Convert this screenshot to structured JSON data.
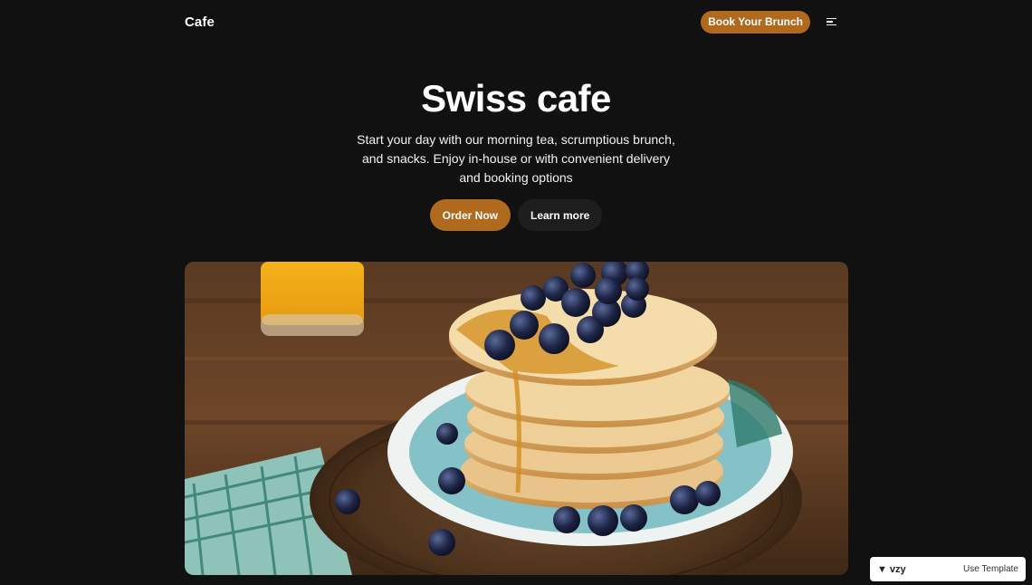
{
  "header": {
    "brand": "Cafe",
    "book_button": "Book Your Brunch",
    "menu_icon": "menu-icon"
  },
  "hero": {
    "title": "Swiss cafe",
    "subtitle_lines": [
      "Start your day with our morning tea, scrumptious brunch,",
      "and snacks. Enjoy in-house or with convenient delivery",
      "and booking options"
    ],
    "primary_button": "Order Now",
    "secondary_button": "Learn more"
  },
  "image": {
    "icon": "pancake-stack-photo"
  },
  "badge": {
    "logo_text": "vzy",
    "link": "Use Template"
  },
  "colors": {
    "background": "#111111",
    "accent": "#b06a1e",
    "secondary_button": "#1e1e1e",
    "text": "#ffffff"
  }
}
